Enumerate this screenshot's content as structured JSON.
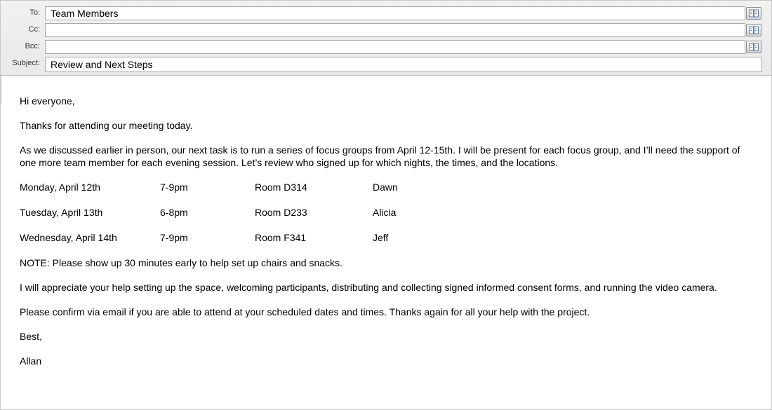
{
  "header": {
    "to_label": "To:",
    "to_value": "Team Members",
    "cc_label": "Cc:",
    "cc_value": "",
    "bcc_label": "Bcc:",
    "bcc_value": "",
    "subject_label": "Subject:",
    "subject_value": "Review and Next Steps"
  },
  "icons": {
    "address_book": "address-book-icon"
  },
  "body": {
    "greeting": "Hi everyone,",
    "p1": "Thanks for attending our meeting today.",
    "p2": "As we discussed earlier in person, our next task is to run a series of focus groups from April 12-15th.  I will be present for each focus group, and I’ll need the support of one more team member for each evening session.  Let’s review who signed up for which nights, the times, and the locations.",
    "schedule": [
      {
        "day": "Monday, April 12th",
        "time": "7-9pm",
        "room": "Room D314",
        "name": "Dawn"
      },
      {
        "day": "Tuesday, April 13th",
        "time": "6-8pm",
        "room": "Room D233",
        "name": "Alicia"
      },
      {
        "day": "Wednesday, April 14th",
        "time": "7-9pm",
        "room": "Room F341",
        "name": "Jeff"
      }
    ],
    "note": "NOTE:  Please show up 30 minutes early to help set up chairs and snacks.",
    "p3": "I will appreciate your help setting up the space, welcoming participants, distributing and collecting signed informed consent forms, and running the video camera.",
    "p4": "Please confirm via email if you are able to attend at your scheduled dates and times.  Thanks again for all your help with the project.",
    "closing": "Best,",
    "signature": "Allan"
  }
}
